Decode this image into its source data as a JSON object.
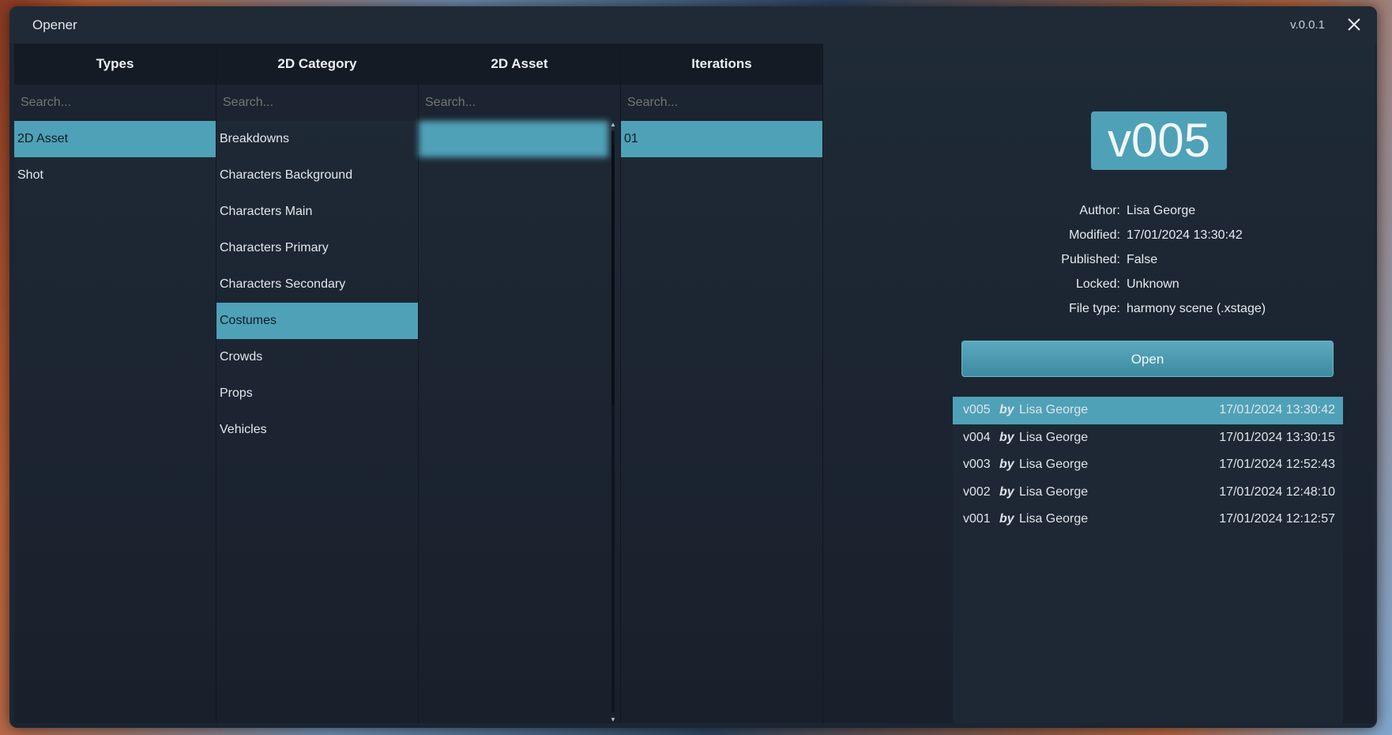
{
  "window": {
    "title": "Opener",
    "version": "v.0.0.1"
  },
  "columns": {
    "types": {
      "header": "Types",
      "search_placeholder": "Search...",
      "items": [
        "2D Asset",
        "Shot"
      ],
      "selected": 0
    },
    "category": {
      "header": "2D Category",
      "search_placeholder": "Search...",
      "items": [
        "Breakdowns",
        "Characters Background",
        "Characters Main",
        "Characters Primary",
        "Characters Secondary",
        "Costumes",
        "Crowds",
        "Props",
        "Vehicles"
      ],
      "selected": 5
    },
    "asset": {
      "header": "2D Asset",
      "search_placeholder": "Search...",
      "items": [
        "",
        "",
        "",
        "",
        "",
        "",
        "",
        "",
        "",
        "",
        "",
        "",
        "",
        "",
        "",
        "",
        ""
      ],
      "selected": 0
    },
    "iterations": {
      "header": "Iterations",
      "search_placeholder": "Search...",
      "items": [
        "01"
      ],
      "selected": 0
    }
  },
  "detail": {
    "version": "v005",
    "fields": [
      {
        "key": "Author:",
        "value": "Lisa George"
      },
      {
        "key": "Modified:",
        "value": "17/01/2024 13:30:42"
      },
      {
        "key": "Published:",
        "value": "False"
      },
      {
        "key": "Locked:",
        "value": "Unknown"
      },
      {
        "key": "File type:",
        "value": "harmony scene (.xstage)"
      }
    ],
    "open_label": "Open",
    "history": [
      {
        "ver": "v005",
        "by": "by",
        "who": "Lisa George",
        "when": "17/01/2024 13:30:42"
      },
      {
        "ver": "v004",
        "by": "by",
        "who": "Lisa George",
        "when": "17/01/2024 13:30:15"
      },
      {
        "ver": "v003",
        "by": "by",
        "who": "Lisa George",
        "when": "17/01/2024 12:52:43"
      },
      {
        "ver": "v002",
        "by": "by",
        "who": "Lisa George",
        "when": "17/01/2024 12:48:10"
      },
      {
        "ver": "v001",
        "by": "by",
        "who": "Lisa George",
        "when": "17/01/2024 12:12:57"
      }
    ],
    "history_selected": 0
  }
}
